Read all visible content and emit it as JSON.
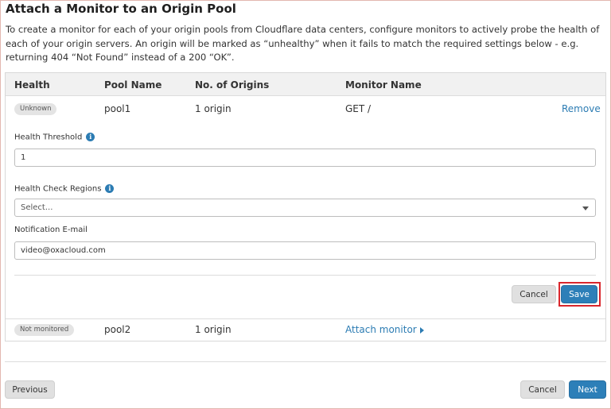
{
  "title": "Attach a Monitor to an Origin Pool",
  "description": "To create a monitor for each of your origin pools from Cloudflare data centers, configure monitors to actively probe the health of each of your origin servers. An origin will be marked as “unhealthy” when it fails to match the required settings below - e.g. returning 404 “Not Found” instead of a 200 “OK”.",
  "table": {
    "headers": [
      "Health",
      "Pool Name",
      "No. of Origins",
      "Monitor Name"
    ],
    "rows": [
      {
        "health": "Unknown",
        "pool": "pool1",
        "origins": "1 origin",
        "monitor": "GET /",
        "action": "Remove"
      },
      {
        "health": "Not monitored",
        "pool": "pool2",
        "origins": "1 origin",
        "action": "Attach monitor"
      }
    ]
  },
  "form": {
    "threshold_label": "Health Threshold",
    "threshold_value": "1",
    "regions_label": "Health Check Regions",
    "regions_placeholder": "Select...",
    "email_label": "Notification E-mail",
    "email_value": "video@oxacloud.com",
    "cancel_label": "Cancel",
    "save_label": "Save"
  },
  "footer": {
    "previous_label": "Previous",
    "cancel_label": "Cancel",
    "next_label": "Next"
  },
  "icons": {
    "info": "info-icon",
    "dropdown": "chevron-down-icon",
    "attach_arrow": "caret-right-icon"
  },
  "colors": {
    "primary": "#2d7fb8",
    "link": "#2c7cb3",
    "highlight": "#d9262c"
  }
}
